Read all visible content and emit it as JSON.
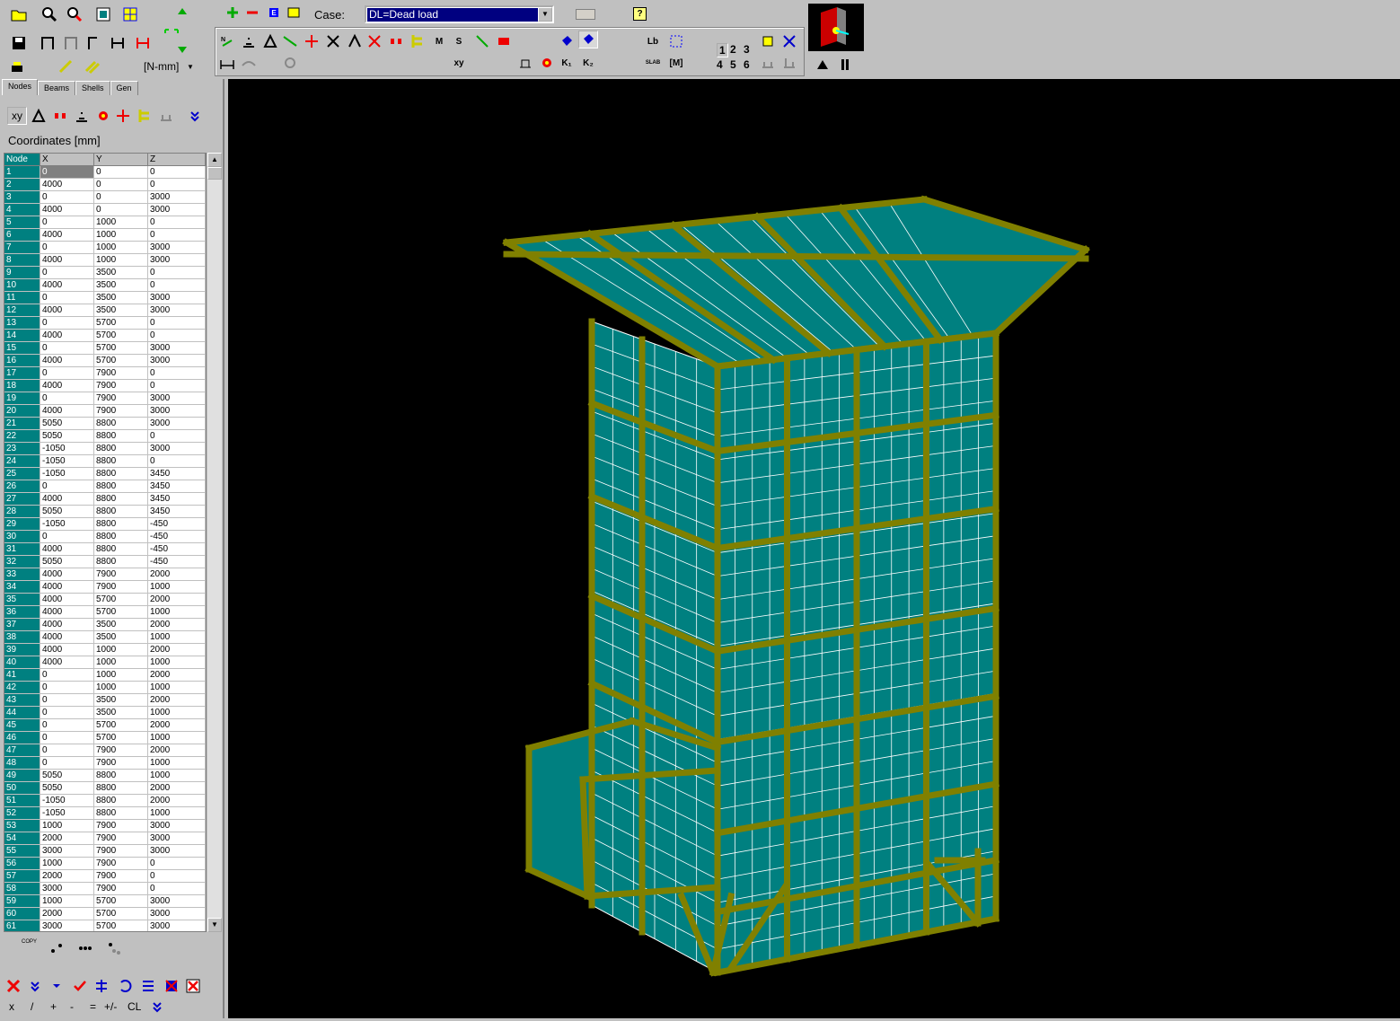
{
  "toolbar": {
    "units": "[N-mm]",
    "case_label": "Case:",
    "case_value": "DL=Dead load",
    "help": "?",
    "btn_M": "M",
    "btn_S": "S",
    "btn_xy": "xy",
    "btn_Lb": "Lb",
    "btn_K1": "K₁",
    "btn_K2": "K₂",
    "btn_M2": "[M]",
    "btn_slab": "SLAB",
    "nums_row1": [
      "1",
      "2",
      "3"
    ],
    "nums_row2": [
      "4",
      "5",
      "6"
    ]
  },
  "tabs": [
    "Nodes",
    "Beams",
    "Shells",
    "Gen"
  ],
  "panel": {
    "xy_btn": "xy",
    "coords_title": "Coordinates   [mm]"
  },
  "grid": {
    "headers": [
      "Node",
      "X",
      "Y",
      "Z"
    ],
    "rows": [
      [
        "1",
        "0",
        "0",
        "0"
      ],
      [
        "2",
        "4000",
        "0",
        "0"
      ],
      [
        "3",
        "0",
        "0",
        "3000"
      ],
      [
        "4",
        "4000",
        "0",
        "3000"
      ],
      [
        "5",
        "0",
        "1000",
        "0"
      ],
      [
        "6",
        "4000",
        "1000",
        "0"
      ],
      [
        "7",
        "0",
        "1000",
        "3000"
      ],
      [
        "8",
        "4000",
        "1000",
        "3000"
      ],
      [
        "9",
        "0",
        "3500",
        "0"
      ],
      [
        "10",
        "4000",
        "3500",
        "0"
      ],
      [
        "11",
        "0",
        "3500",
        "3000"
      ],
      [
        "12",
        "4000",
        "3500",
        "3000"
      ],
      [
        "13",
        "0",
        "5700",
        "0"
      ],
      [
        "14",
        "4000",
        "5700",
        "0"
      ],
      [
        "15",
        "0",
        "5700",
        "3000"
      ],
      [
        "16",
        "4000",
        "5700",
        "3000"
      ],
      [
        "17",
        "0",
        "7900",
        "0"
      ],
      [
        "18",
        "4000",
        "7900",
        "0"
      ],
      [
        "19",
        "0",
        "7900",
        "3000"
      ],
      [
        "20",
        "4000",
        "7900",
        "3000"
      ],
      [
        "21",
        "5050",
        "8800",
        "3000"
      ],
      [
        "22",
        "5050",
        "8800",
        "0"
      ],
      [
        "23",
        "-1050",
        "8800",
        "3000"
      ],
      [
        "24",
        "-1050",
        "8800",
        "0"
      ],
      [
        "25",
        "-1050",
        "8800",
        "3450"
      ],
      [
        "26",
        "0",
        "8800",
        "3450"
      ],
      [
        "27",
        "4000",
        "8800",
        "3450"
      ],
      [
        "28",
        "5050",
        "8800",
        "3450"
      ],
      [
        "29",
        "-1050",
        "8800",
        "-450"
      ],
      [
        "30",
        "0",
        "8800",
        "-450"
      ],
      [
        "31",
        "4000",
        "8800",
        "-450"
      ],
      [
        "32",
        "5050",
        "8800",
        "-450"
      ],
      [
        "33",
        "4000",
        "7900",
        "2000"
      ],
      [
        "34",
        "4000",
        "7900",
        "1000"
      ],
      [
        "35",
        "4000",
        "5700",
        "2000"
      ],
      [
        "36",
        "4000",
        "5700",
        "1000"
      ],
      [
        "37",
        "4000",
        "3500",
        "2000"
      ],
      [
        "38",
        "4000",
        "3500",
        "1000"
      ],
      [
        "39",
        "4000",
        "1000",
        "2000"
      ],
      [
        "40",
        "4000",
        "1000",
        "1000"
      ],
      [
        "41",
        "0",
        "1000",
        "2000"
      ],
      [
        "42",
        "0",
        "1000",
        "1000"
      ],
      [
        "43",
        "0",
        "3500",
        "2000"
      ],
      [
        "44",
        "0",
        "3500",
        "1000"
      ],
      [
        "45",
        "0",
        "5700",
        "2000"
      ],
      [
        "46",
        "0",
        "5700",
        "1000"
      ],
      [
        "47",
        "0",
        "7900",
        "2000"
      ],
      [
        "48",
        "0",
        "7900",
        "1000"
      ],
      [
        "49",
        "5050",
        "8800",
        "1000"
      ],
      [
        "50",
        "5050",
        "8800",
        "2000"
      ],
      [
        "51",
        "-1050",
        "8800",
        "2000"
      ],
      [
        "52",
        "-1050",
        "8800",
        "1000"
      ],
      [
        "53",
        "1000",
        "7900",
        "3000"
      ],
      [
        "54",
        "2000",
        "7900",
        "3000"
      ],
      [
        "55",
        "3000",
        "7900",
        "3000"
      ],
      [
        "56",
        "1000",
        "7900",
        "0"
      ],
      [
        "57",
        "2000",
        "7900",
        "0"
      ],
      [
        "58",
        "3000",
        "7900",
        "0"
      ],
      [
        "59",
        "1000",
        "5700",
        "3000"
      ],
      [
        "60",
        "2000",
        "5700",
        "3000"
      ],
      [
        "61",
        "3000",
        "5700",
        "3000"
      ]
    ]
  },
  "bottom": {
    "copy": "COPY",
    "calc_keys": [
      "x",
      "/",
      "+",
      "-",
      "=",
      "+/-",
      "CL"
    ]
  },
  "colors": {
    "shell": "#008080",
    "beam": "#808000",
    "background": "#000000"
  }
}
